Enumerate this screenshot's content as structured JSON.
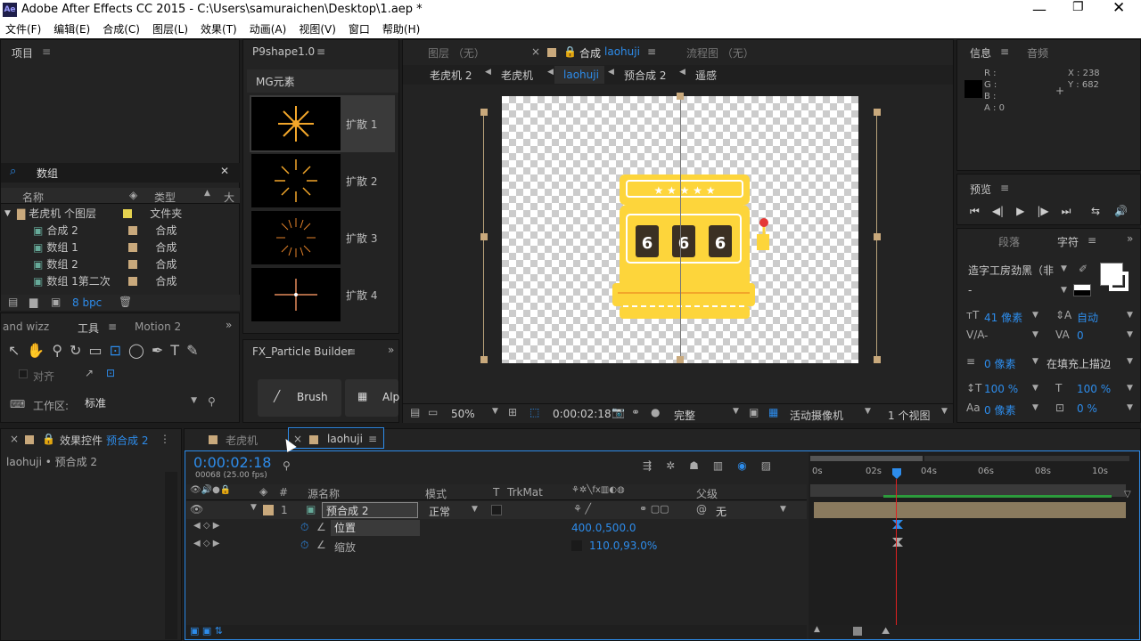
{
  "window": {
    "title": "Adobe After Effects CC 2015 - C:\\Users\\samuraichen\\Desktop\\1.aep *",
    "app_icon": "Ae"
  },
  "menu": [
    "文件(F)",
    "编辑(E)",
    "合成(C)",
    "图层(L)",
    "效果(T)",
    "动画(A)",
    "视图(V)",
    "窗口",
    "帮助(H)"
  ],
  "project": {
    "title": "项目",
    "search": "数组",
    "columns": {
      "name": "名称",
      "type": "类型",
      "size": "大"
    },
    "items": [
      {
        "name": "老虎机 个图层",
        "type": "文件夹",
        "color": "#e5d24f"
      },
      {
        "name": "合成 2",
        "type": "合成",
        "color": "#c9a97c"
      },
      {
        "name": "数组 1",
        "type": "合成",
        "color": "#c9a97c"
      },
      {
        "name": "数组 2",
        "type": "合成",
        "color": "#c9a97c"
      },
      {
        "name": "数组 1第二次",
        "type": "合成",
        "color": "#c9a97c"
      }
    ],
    "bpc": "8 bpc"
  },
  "tools": {
    "tabs": [
      "and wizz",
      "工具",
      "Motion 2"
    ],
    "align": "对齐",
    "workspace_label": "工作区:",
    "workspace_value": "标准"
  },
  "effects_panel": {
    "title": "效果控件",
    "comp": "预合成 2",
    "path": "laohuji • 预合成 2"
  },
  "p9": {
    "title": "P9shape1.0",
    "section": "MG元素",
    "items": [
      "扩散 1",
      "扩散 2",
      "扩散 3",
      "扩散 4"
    ]
  },
  "fx": {
    "title": "FX_Particle Builder",
    "brush": "Brush",
    "alp": "Alp"
  },
  "viewer": {
    "tabs": {
      "layer": "图层 （无）",
      "comp_prefix": "合成",
      "comp": "laohuji",
      "flow": "流程图 （无）"
    },
    "breadcrumbs": [
      "老虎机 2",
      "老虎机",
      "laohuji",
      "预合成 2",
      "遥感"
    ],
    "zoom": "50%",
    "time": "0:00:02:18",
    "quality": "完整",
    "camera": "活动摄像机",
    "views": "1 个视图"
  },
  "info": {
    "title": "信息",
    "audio": "音频",
    "r": "R :",
    "g": "G :",
    "b": "B :",
    "a": "A : 0",
    "x": "X : 238",
    "y": "Y : 682"
  },
  "preview": {
    "title": "预览"
  },
  "character": {
    "tabs": [
      "段落",
      "字符"
    ],
    "font": "造字工房劲黑（非",
    "style": "-",
    "size": "41 像素",
    "leading": "自动",
    "kerning": "-",
    "tracking": "0",
    "stroke": "0 像素",
    "stroke_mode": "在填充上描边",
    "vscale": "100 %",
    "hscale": "100 %",
    "baseline": "0 像素",
    "tsume": "0 %"
  },
  "timeline": {
    "tabs": [
      "老虎机",
      "laohuji"
    ],
    "time": "0:00:02:18",
    "fps": "00068 (25.00 fps)",
    "cols": {
      "num": "#",
      "src": "源名称",
      "mode": "模式",
      "t": "T",
      "trkmat": "TrkMat",
      "parent": "父级"
    },
    "layer": {
      "num": "1",
      "name": "预合成 2",
      "mode": "正常",
      "parent": "无"
    },
    "props": [
      {
        "name": "位置",
        "value": "400.0,500.0"
      },
      {
        "name": "缩放",
        "value": "110.0,93.0%"
      }
    ],
    "ruler": [
      "0s",
      "02s",
      "04s",
      "06s",
      "08s",
      "10s"
    ]
  }
}
